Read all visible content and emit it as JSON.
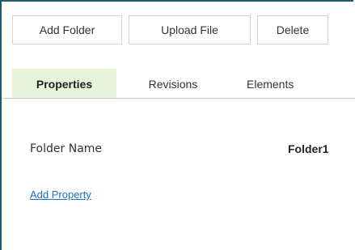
{
  "toolbar": {
    "add_folder": "Add Folder",
    "upload_file": "Upload File",
    "delete": "Delete"
  },
  "tabs": [
    {
      "label": "Properties",
      "active": true
    },
    {
      "label": "Revisions",
      "active": false
    },
    {
      "label": "Elements",
      "active": false
    }
  ],
  "properties": {
    "folder_name_label": "Folder Name",
    "folder_name_value": "Folder1",
    "add_property_link": "Add Property"
  },
  "colors": {
    "frame_border": "#1d5b6e",
    "active_tab_bg": "#e8f3dc",
    "link": "#1a73c9"
  }
}
